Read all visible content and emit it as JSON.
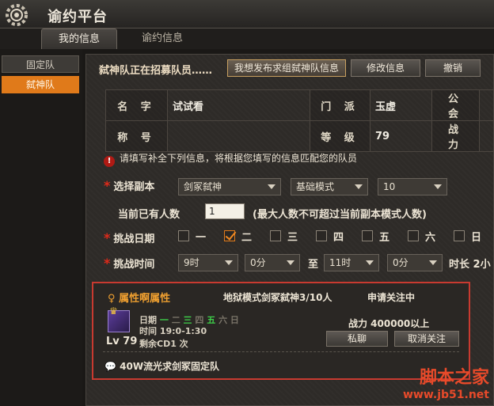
{
  "app": {
    "title": "谕约平台"
  },
  "tabs": [
    {
      "label": "我的信息"
    },
    {
      "label": "谕约信息"
    }
  ],
  "sidebar": {
    "items": [
      {
        "label": "固定队"
      },
      {
        "label": "弑神队"
      }
    ]
  },
  "header": {
    "recruit_text": "弑神队正在招募队员……",
    "publish_button": "我想发布求组弑神队信息",
    "edit_button": "修改信息",
    "cancel_button": "撤销"
  },
  "info": {
    "name_label": "名 字",
    "name_value": "试试看",
    "sect_label": "门 派",
    "sect_value": "玉虚",
    "guild_label": "公 会",
    "title_label": "称 号",
    "level_label": "等 级",
    "level_value": "79",
    "power_label": "战 力"
  },
  "notice": "请填写补全下列信息，将根据您填写的信息匹配您的队员",
  "form": {
    "dungeon_label": "选择副本",
    "dungeon_value": "剑冢弑神",
    "mode_value": "基础模式",
    "count_value": "10",
    "current_label": "当前已有人数",
    "current_value": "1",
    "current_hint": "(最大人数不可超过当前副本模式人数)",
    "date_label": "挑战日期",
    "days": [
      {
        "label": "一",
        "checked": false
      },
      {
        "label": "二",
        "checked": true
      },
      {
        "label": "三",
        "checked": false
      },
      {
        "label": "四",
        "checked": false
      },
      {
        "label": "五",
        "checked": false
      },
      {
        "label": "六",
        "checked": false
      },
      {
        "label": "日",
        "checked": false
      }
    ],
    "time_label": "挑战时间",
    "start_hour": "9时",
    "start_min": "0分",
    "to": "至",
    "end_hour": "11时",
    "end_min": "0分",
    "duration": "时长 2小"
  },
  "card": {
    "team_name": "属性啊属性",
    "mode": "地狱模式剑冢弑神3/10人",
    "status": "申请关注中",
    "date_label": "日期",
    "days": [
      {
        "label": "一",
        "on": true
      },
      {
        "label": "二",
        "on": false
      },
      {
        "label": "三",
        "on": true
      },
      {
        "label": "四",
        "on": false
      },
      {
        "label": "五",
        "on": true
      },
      {
        "label": "六",
        "on": false
      },
      {
        "label": "日",
        "on": false
      }
    ],
    "time_text": "时间  19:0-1:30",
    "cd_text": "剩余CD1 次",
    "level": "Lv 79",
    "power": "战力  400000以上",
    "chat_button": "私聊",
    "unfollow_button": "取消关注",
    "message": "40W流光求剑冢固定队"
  },
  "watermark": {
    "line1": "脚本之家",
    "line2": "www.jb51.net"
  }
}
